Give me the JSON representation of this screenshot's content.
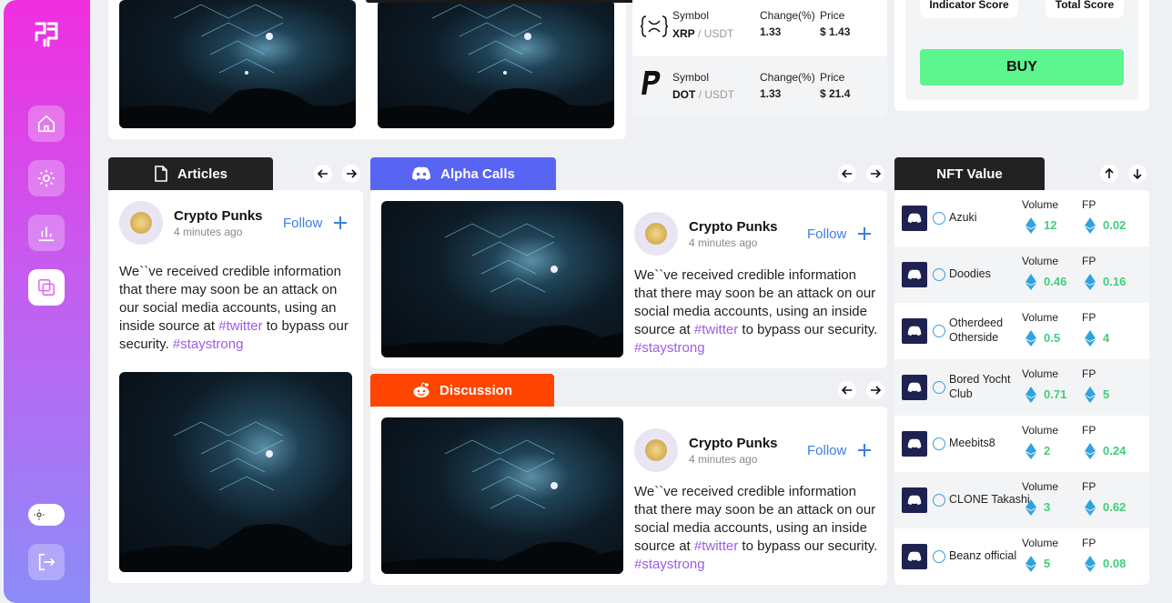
{
  "tokens": [
    {
      "symbol_label": "Symbol",
      "symbol": "XRP",
      "pair": " / USDT",
      "change_label": "Change(%)",
      "change": "1.33",
      "price_label": "Price",
      "price": "$ 1.43",
      "icon": "xrp-icon"
    },
    {
      "symbol_label": "Symbol",
      "symbol": "DOT",
      "pair": " / USDT",
      "change_label": "Change(%)",
      "change": "1.33",
      "price_label": "Price",
      "price": "$ 21.4",
      "icon": "paypal-icon"
    }
  ],
  "score": {
    "indicator": "Indicator Score",
    "total": "Total Score",
    "buy": "BUY"
  },
  "tabs": {
    "articles": "Articles",
    "alpha": "Alpha Calls",
    "discussion": "Discussion",
    "nft": "NFT Value"
  },
  "post": {
    "name": "Crypto Punks",
    "time": "4 minutes ago",
    "follow": "Follow",
    "text1": "We``ve received credible information that there may soon be an attack on our social media accounts, using an inside source at ",
    "tag1": "#twitter",
    "text2": " to bypass our security. ",
    "tag2": "#staystrong"
  },
  "nft": {
    "volume_label": "Volume",
    "fp_label": "FP",
    "items": [
      {
        "name": "Azuki",
        "volume": "12",
        "fp": "0.02"
      },
      {
        "name": "Doodies",
        "volume": "0.46",
        "fp": "0.16"
      },
      {
        "name": "Otherdeed Otherside",
        "volume": "0.5",
        "fp": "4"
      },
      {
        "name": "Bored Yocht Club",
        "volume": "0.71",
        "fp": "5"
      },
      {
        "name": "Meebits8",
        "volume": "2",
        "fp": "0.24"
      },
      {
        "name": "CLONE Takashi",
        "volume": "3",
        "fp": "0.62"
      },
      {
        "name": "Beanz official",
        "volume": "5",
        "fp": "0.08"
      }
    ]
  },
  "colors": {
    "articles_tab": "#222222",
    "alpha_tab": "#5865f2",
    "discussion_tab": "#ff4500",
    "buy": "#5df58e",
    "accent_green": "#3dcf7a",
    "follow": "#3c7ee6",
    "hashtag": "#9b5de5"
  }
}
